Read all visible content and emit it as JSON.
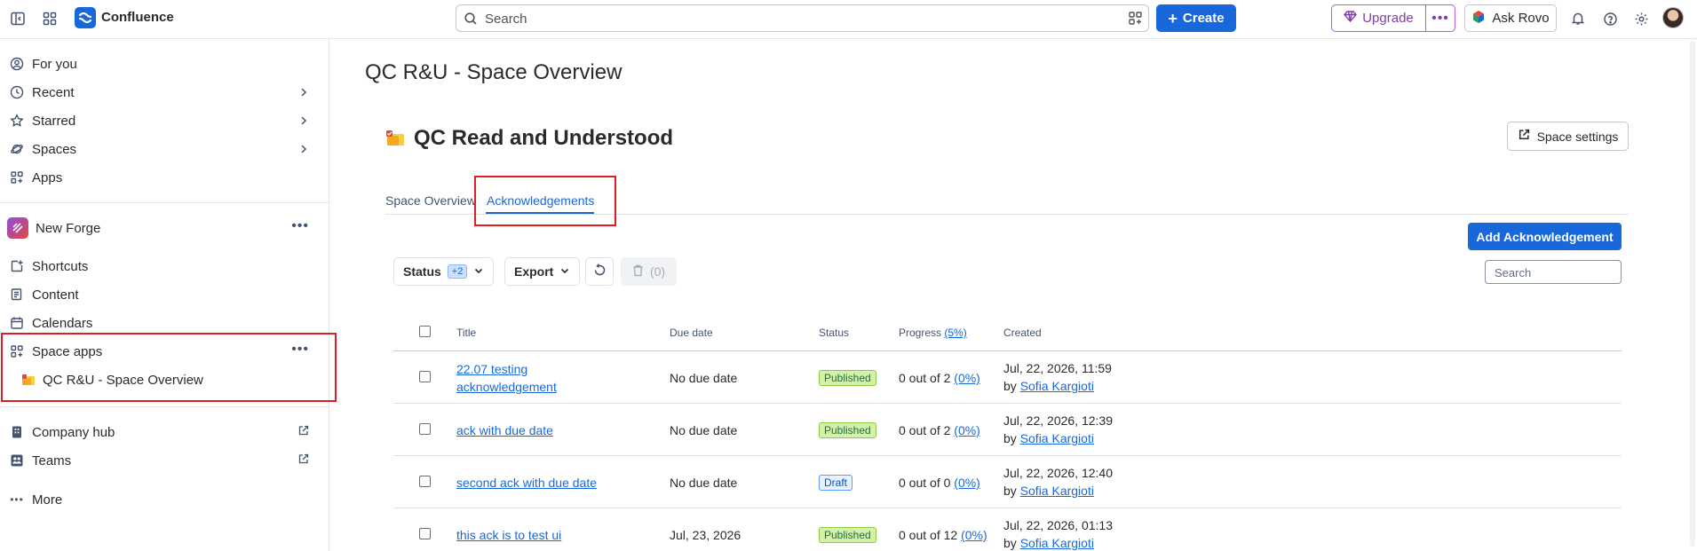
{
  "topbar": {
    "brand": "Confluence",
    "search_placeholder": "Search",
    "create_label": "Create",
    "upgrade_label": "Upgrade",
    "ask_rovo_label": "Ask Rovo"
  },
  "sidebar": {
    "items": [
      {
        "label": "For you"
      },
      {
        "label": "Recent"
      },
      {
        "label": "Starred"
      },
      {
        "label": "Spaces"
      },
      {
        "label": "Apps"
      }
    ],
    "space_name": "New Forge",
    "space_items": [
      {
        "label": "Shortcuts"
      },
      {
        "label": "Content"
      },
      {
        "label": "Calendars"
      },
      {
        "label": "Space apps"
      }
    ],
    "space_app_child": "QC R&U - Space Overview",
    "footer_items": [
      {
        "label": "Company hub"
      },
      {
        "label": "Teams"
      },
      {
        "label": "More"
      }
    ]
  },
  "main": {
    "page_title": "QC R&U - Space Overview",
    "space_title": "QC Read and Understood",
    "space_settings_label": "Space settings",
    "tabs": [
      {
        "label": "Space Overview"
      },
      {
        "label": "Acknowledgements"
      }
    ],
    "add_ack_label": "Add Acknowledgement",
    "filters": {
      "status_label": "Status",
      "status_badge": "+2",
      "export_label": "Export",
      "delete_count": "(0)"
    },
    "search_placeholder": "Search",
    "table": {
      "headers": {
        "title": "Title",
        "due": "Due date",
        "status": "Status",
        "progress": "Progress",
        "progress_pct": "(5%)",
        "created": "Created"
      },
      "rows": [
        {
          "title_line1": "22.07 testing",
          "title_line2": "acknowledgement",
          "due": "No due date",
          "status": "Published",
          "progress": "0 out of 2",
          "progress_pct": "(0%)",
          "created_date": "Jul, 22, 2026, 11:59",
          "by": "by",
          "author": "Sofia Kargioti"
        },
        {
          "title_line1": "ack with due date",
          "due": "No due date",
          "status": "Published",
          "progress": "0 out of 2",
          "progress_pct": "(0%)",
          "created_date": "Jul, 22, 2026, 12:39",
          "by": "by",
          "author": "Sofia Kargioti"
        },
        {
          "title_line1": "second ack with due date",
          "due": "No due date",
          "status": "Draft",
          "progress": "0 out of 0",
          "progress_pct": "(0%)",
          "created_date": "Jul, 22, 2026, 12:40",
          "by": "by",
          "author": "Sofia Kargioti"
        },
        {
          "title_line1": "this ack is to test ui",
          "due": "Jul, 23, 2026",
          "status": "Published",
          "progress": "0 out of 12",
          "progress_pct": "(0%)",
          "created_date": "Jul, 22, 2026, 01:13",
          "by": "by",
          "author": "Sofia Kargioti"
        }
      ]
    }
  },
  "colors": {
    "brand_blue": "#1868db",
    "highlight_red": "#e01b24",
    "published_bg": "#d3f1a7",
    "draft_bg": "#e9f2ff"
  }
}
